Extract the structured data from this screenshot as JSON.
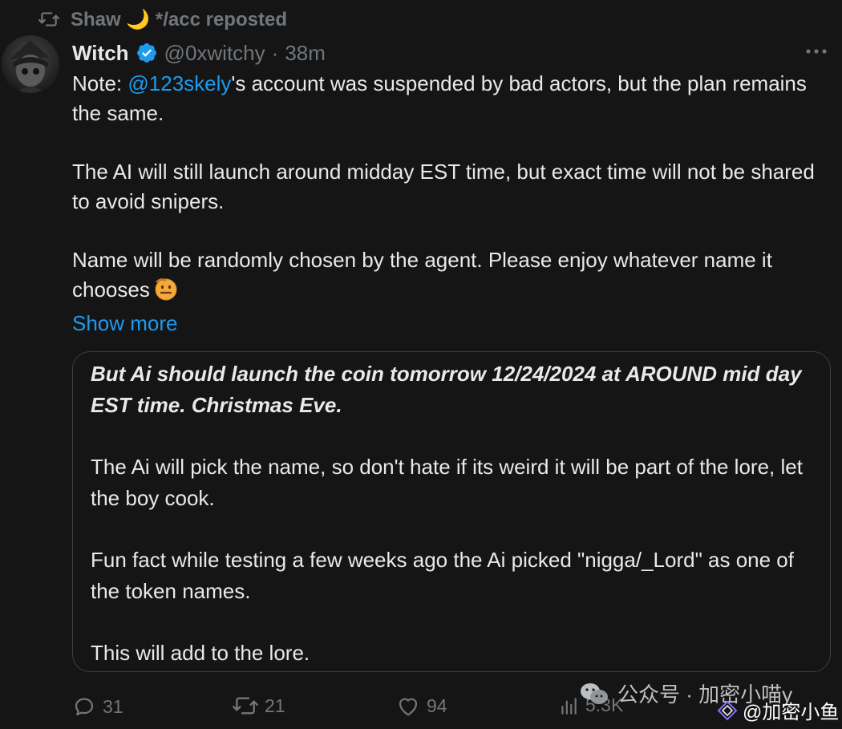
{
  "repost": {
    "text": "Shaw 🌙 */acc reposted"
  },
  "tweet": {
    "author_name": "Witch",
    "handle": "@0xwitchy",
    "separator": "·",
    "time": "38m",
    "paragraphs": {
      "p1_prefix": "Note: ",
      "p1_mention": "@123skely",
      "p1_suffix": "'s account was suspended by bad actors, but the plan remains the same.",
      "p2": "The AI will still launch around midday EST time, but exact time will not be shared to avoid snipers.",
      "p3": "Name will be randomly chosen by the agent. Please enjoy whatever name it chooses"
    },
    "show_more": "Show more"
  },
  "quote": {
    "bold_text": "But Ai should launch the coin tomorrow 12/24/2024 at AROUND mid day EST time. Christmas Eve.",
    "p2": "The Ai will pick the name, so don't hate if its weird it will be part of the lore, let the boy cook.",
    "p3": "Fun fact while testing a few weeks ago the Ai picked \"nigga/_Lord\" as one of the token names.",
    "p4": "This will add to the lore."
  },
  "actions": {
    "replies": "31",
    "reposts": "21",
    "likes": "94",
    "views": "5.3K"
  },
  "watermark": {
    "channel": "公众号 · 加密小喵y",
    "account": "@加密小鱼"
  },
  "colors": {
    "background": "#151515",
    "text": "#e7e9ea",
    "muted": "#71767b",
    "accent": "#1d9bf0",
    "border": "#3b3f44"
  },
  "icons": {
    "repost": "repost-icon",
    "verified": "verified-badge-icon",
    "more": "more-dots-icon",
    "reply": "reply-icon",
    "like": "heart-icon",
    "views": "views-chart-icon",
    "emoji": "zipper-mouth-face-emoji"
  }
}
